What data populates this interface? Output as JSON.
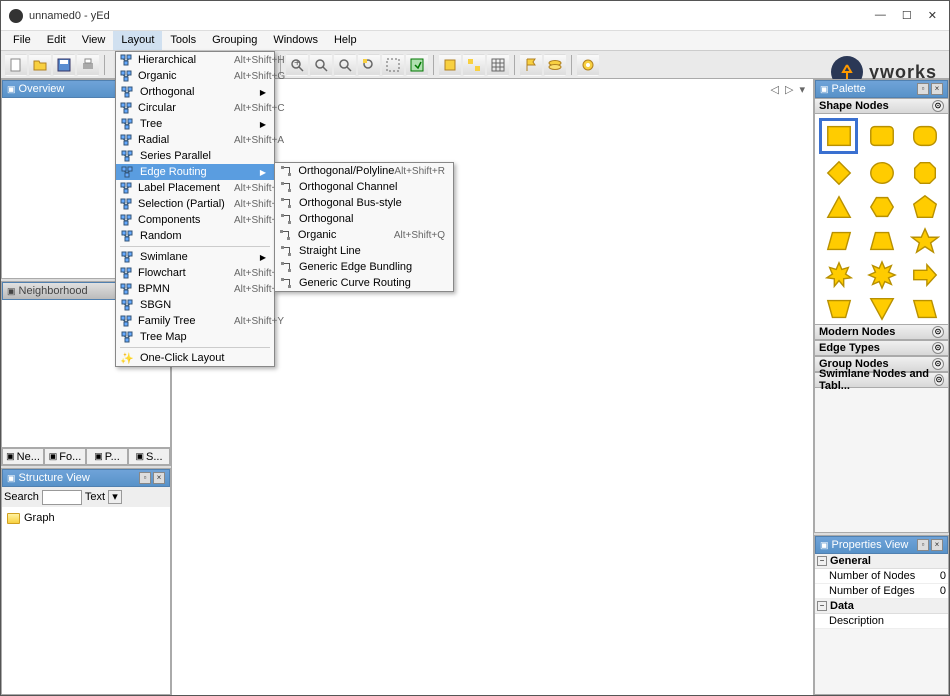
{
  "window": {
    "title": "unnamed0 - yEd",
    "logo_text": "yworks"
  },
  "menubar": [
    "File",
    "Edit",
    "View",
    "Layout",
    "Tools",
    "Grouping",
    "Windows",
    "Help"
  ],
  "layout_menu": [
    {
      "label": "Hierarchical",
      "shortcut": "Alt+Shift+H"
    },
    {
      "label": "Organic",
      "shortcut": "Alt+Shift+G"
    },
    {
      "label": "Orthogonal",
      "sub": true
    },
    {
      "label": "Circular",
      "shortcut": "Alt+Shift+C"
    },
    {
      "label": "Tree",
      "sub": true
    },
    {
      "label": "Radial",
      "shortcut": "Alt+Shift+A"
    },
    {
      "label": "Series Parallel"
    },
    {
      "label": "Edge Routing",
      "sub": true,
      "highlighted": true
    },
    {
      "label": "Label Placement",
      "shortcut": "Alt+Shift+L"
    },
    {
      "label": "Selection (Partial)",
      "shortcut": "Alt+Shift+P"
    },
    {
      "label": "Components",
      "shortcut": "Alt+Shift+M"
    },
    {
      "label": "Random"
    },
    {
      "sep": true
    },
    {
      "label": "Swimlane",
      "sub": true
    },
    {
      "label": "Flowchart",
      "shortcut": "Alt+Shift+F"
    },
    {
      "label": "BPMN",
      "shortcut": "Alt+Shift+B"
    },
    {
      "label": "SBGN"
    },
    {
      "label": "Family Tree",
      "shortcut": "Alt+Shift+Y"
    },
    {
      "label": "Tree Map"
    },
    {
      "sep": true
    },
    {
      "label": "One-Click Layout",
      "icon": "wand"
    }
  ],
  "edge_routing_submenu": [
    {
      "label": "Orthogonal/Polyline",
      "shortcut": "Alt+Shift+R"
    },
    {
      "label": "Orthogonal Channel"
    },
    {
      "label": "Orthogonal Bus-style"
    },
    {
      "label": "Orthogonal"
    },
    {
      "label": "Organic",
      "shortcut": "Alt+Shift+Q"
    },
    {
      "label": "Straight Line"
    },
    {
      "label": "Generic Edge Bundling"
    },
    {
      "label": "Generic Curve Routing"
    }
  ],
  "panels": {
    "overview": "Overview",
    "neighborhood": "Neighborhood",
    "structure": "Structure View",
    "palette": "Palette",
    "properties": "Properties View"
  },
  "structure": {
    "search_label": "Search",
    "text_label": "Text",
    "root": "Graph"
  },
  "tabs": [
    "Ne...",
    "Fo...",
    "P...",
    "S..."
  ],
  "palette_sections": [
    "Shape Nodes",
    "Modern Nodes",
    "Edge Types",
    "Group Nodes",
    "Swimlane Nodes and Tabl..."
  ],
  "properties": {
    "groups": [
      {
        "name": "General",
        "rows": [
          {
            "k": "Number of Nodes",
            "v": "0"
          },
          {
            "k": "Number of Edges",
            "v": "0"
          }
        ]
      },
      {
        "name": "Data",
        "rows": [
          {
            "k": "Description",
            "v": ""
          }
        ]
      }
    ]
  }
}
